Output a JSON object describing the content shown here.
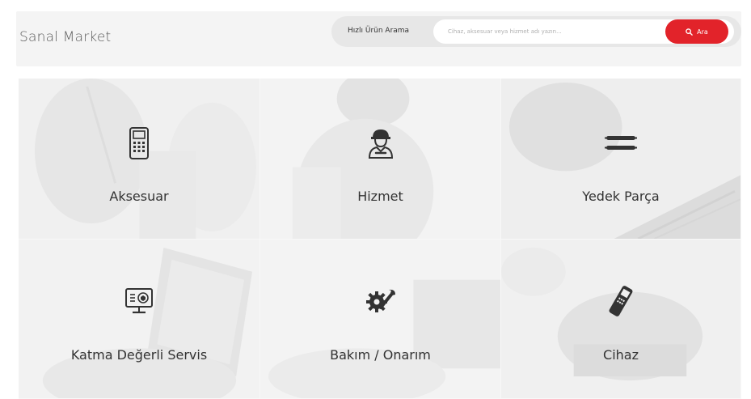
{
  "header": {
    "brand": "Sanal Market",
    "search": {
      "label": "Hızlı Ürün Arama",
      "placeholder": "Cihaz, aksesuar veya hizmet adı yazın...",
      "button_label": "Ara",
      "button_icon": "search-icon"
    }
  },
  "categories": [
    {
      "label": "Aksesuar",
      "icon": "pos-terminal-icon"
    },
    {
      "label": "Hizmet",
      "icon": "technician-icon"
    },
    {
      "label": "Yedek Parça",
      "icon": "rollers-icon"
    },
    {
      "label": "Katma Değerli Servis",
      "icon": "monitor-box-icon"
    },
    {
      "label": "Bakım / Onarım",
      "icon": "gear-wrench-icon"
    },
    {
      "label": "Cihaz",
      "icon": "card-terminal-icon"
    }
  ],
  "colors": {
    "accent": "#e2232a",
    "topbar": "#f4f4f4",
    "pill": "#e7e7e7"
  }
}
